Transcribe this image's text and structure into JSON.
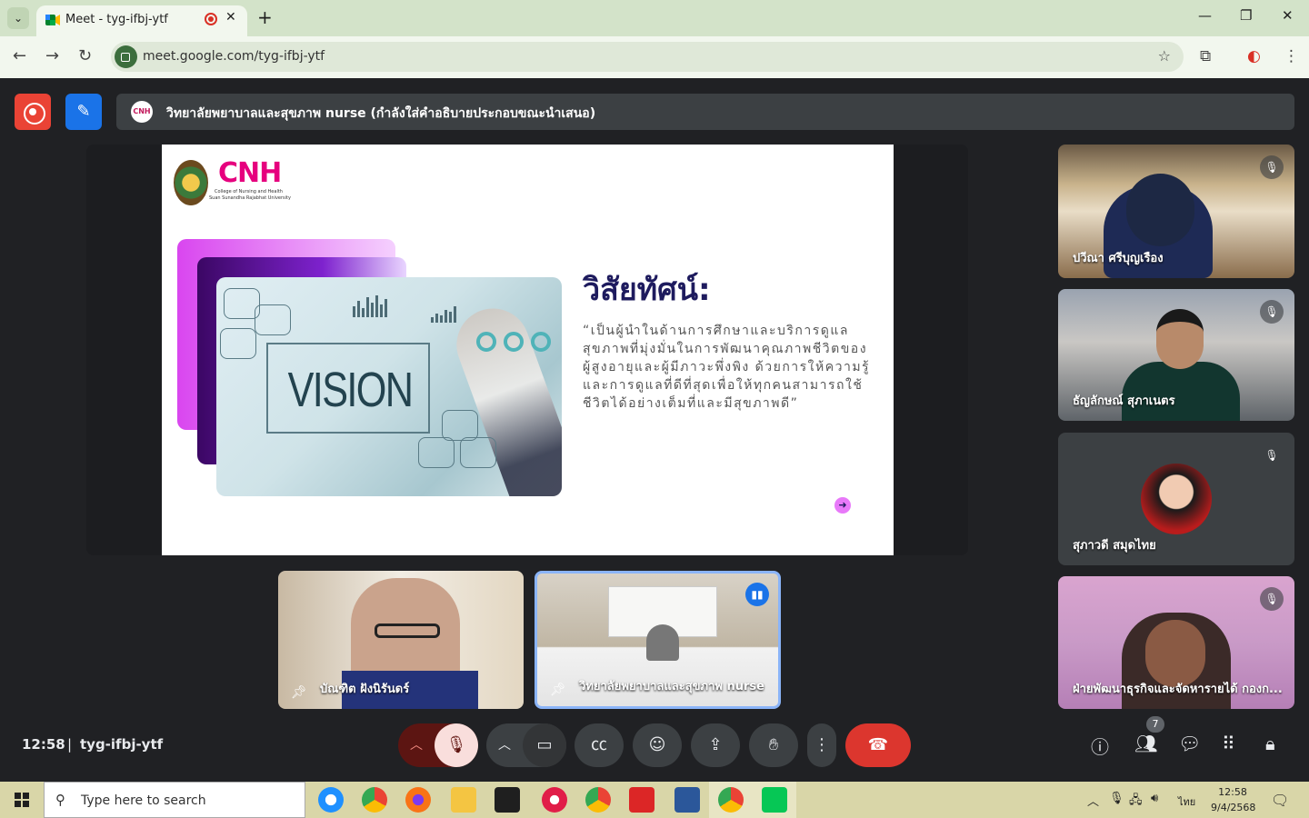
{
  "browser": {
    "tab_title": "Meet - tyg-ifbj-ytf",
    "tab_close": "✕",
    "new_tab": "+",
    "url": "meet.google.com/tyg-ifbj-ytf",
    "min": "—",
    "restore": "❐",
    "close": "✕"
  },
  "meet": {
    "presenter_initials": "CNH",
    "presenting_banner": "วิทยาลัยพยาบาลและสุขภาพ nurse (กำลังใส่คำอธิบายประกอบขณะนำเสนอ)",
    "clock": "12:58",
    "separator": "|",
    "meeting_code": "tyg-ifbj-ytf",
    "participant_count": "7"
  },
  "slide": {
    "logo_text": "CNH",
    "logo_sub1": "College of Nursing and Health",
    "logo_sub2": "Suan Sunandha Rajabhat University",
    "image_word": "VISION",
    "title": "วิสัยทัศน์:",
    "body": "“เป็นผู้นำในด้านการศึกษาและบริการดูแลสุขภาพที่มุ่งมั่นในการพัฒนาคุณภาพชีวิตของผู้สูงอายุและผู้มีภาวะพึ่งพิง ด้วยการให้ความรู้และการดูแลที่ดีที่สุดเพื่อให้ทุกคนสามารถใช้ชีวิตได้อย่างเต็มที่และมีสุขภาพดี”"
  },
  "participants": [
    {
      "name": "ปวีณา ศรีบุญเรือง",
      "muted": true
    },
    {
      "name": "ธัญลักษณ์ สุภาเนตร",
      "muted": true
    },
    {
      "name": "สุภาวดี สมุดไทย",
      "muted": true
    },
    {
      "name": "ฝ่ายพัฒนาธุรกิจและจัดหารายได้ กองก...",
      "muted": true
    },
    {
      "name": "บัณฑิต ฝังนิรันดร์",
      "pinned": true
    },
    {
      "name": "วิทยาลัยพยาบาลและสุขภาพ nurse",
      "pinned": true,
      "speaking": true
    }
  ],
  "taskbar": {
    "search_placeholder": "Type here to search",
    "lang": "ไทย",
    "time": "12:58",
    "date": "9/4/2568"
  },
  "colors": {
    "end_call": "#dc362e",
    "muted_mic": "#f9dedc",
    "speaking_border": "#8ab4f8",
    "accent_pink": "#e6007e"
  }
}
